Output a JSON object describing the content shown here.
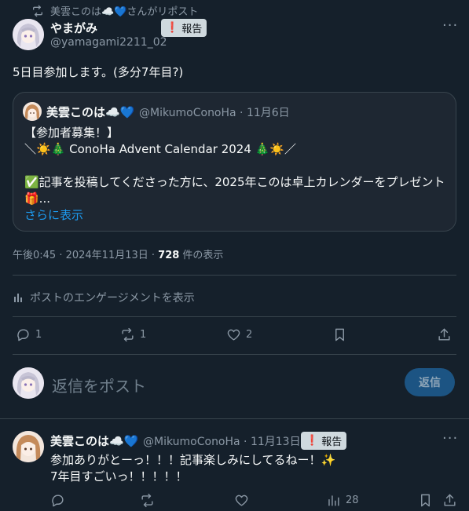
{
  "repost_banner": {
    "text": "美雲このは☁️💙さんがリポスト"
  },
  "main_post": {
    "author_name": "やまがみ",
    "author_handle": "@yamagami2211_02",
    "report_label": "報告",
    "text": "5日目参加します。(多分7年目?)",
    "timestamp": "午後0:45 · 2024年11月13日 · ",
    "views_count": "728",
    "views_label": " 件の表示",
    "engagement_link": "ポストのエンゲージメントを表示",
    "actions": {
      "replies": "1",
      "reposts": "1",
      "likes": "2"
    }
  },
  "quoted_post": {
    "author_name": "美雲このは☁️💙",
    "author_handle": "@MikumoConoHa · 11月6日",
    "line1": "【参加者募集！】",
    "line2": "＼☀️🎄 ConoHa Advent Calendar 2024 🎄☀️／",
    "line3": "✅記事を投稿してくださった方に、2025年このは卓上カレンダーをプレゼント",
    "line4": "🎁...",
    "show_more": "さらに表示"
  },
  "composer": {
    "placeholder": "返信をポスト",
    "reply_button": "返信"
  },
  "reply_post": {
    "author_name": "美雲このは☁️💙",
    "author_handle": "@MikumoConoHa · 11月13日",
    "report_label": "報告",
    "line1": "参加ありがとーっ！！！記事楽しみにしてるねー！✨",
    "line2": "7年目すごいっ！！！！！",
    "views": "28"
  },
  "colors": {
    "background": "#15202b",
    "link": "#1d9bf0",
    "muted": "#8b98a5",
    "border": "#38444d"
  }
}
